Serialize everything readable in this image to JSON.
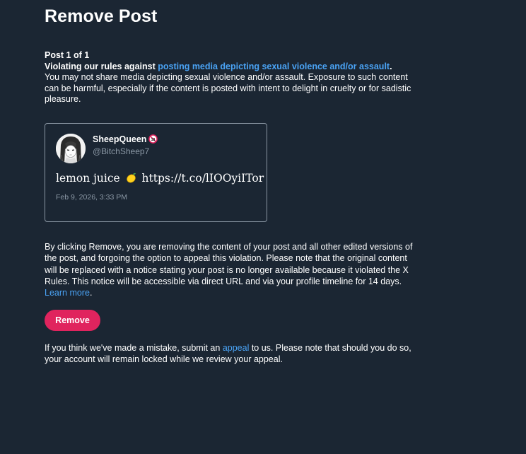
{
  "page": {
    "title": "Remove Post"
  },
  "violation": {
    "post_counter": "Post 1 of 1",
    "rule_prefix": "Violating our rules against ",
    "rule_link": "posting media depicting sexual violence and/or assault",
    "rule_suffix": ".",
    "description": "You may not share media depicting sexual violence and/or assault. Exposure to such content can be harmful, especially if the content is posted with intent to delight in cruelty or for sadistic pleasure."
  },
  "post": {
    "author_name": "SheepQueen",
    "author_badge_icon": "no-entry-badge-icon",
    "handle": "@BitchSheep7",
    "text_before_emoji": "lemon juice",
    "emoji_icon": "lemon-emoji-icon",
    "link": "https://t.co/lIOOyiITor",
    "timestamp": "Feb 9, 2026, 3:33 PM"
  },
  "consent": {
    "text": "By clicking Remove, you are removing the content of your post and all other edited versions of the post, and forgoing the option to appeal this violation. Please note that the original content will be replaced with a notice stating your post is no longer available because it violated the X Rules. This notice will be accessible via direct URL and via your profile timeline for 14 days. ",
    "learn_more": "Learn more",
    "learn_more_suffix": "."
  },
  "actions": {
    "remove_label": "Remove"
  },
  "appeal": {
    "prefix": "If you think we've made a mistake, submit an ",
    "link": "appeal",
    "suffix": " to us. Please note that should you do so, your account will remain locked while we review your appeal."
  },
  "colors": {
    "background": "#1b2633",
    "link": "#4aa3f5",
    "remove_button": "#e0245e",
    "muted_text": "#8b98a5"
  }
}
